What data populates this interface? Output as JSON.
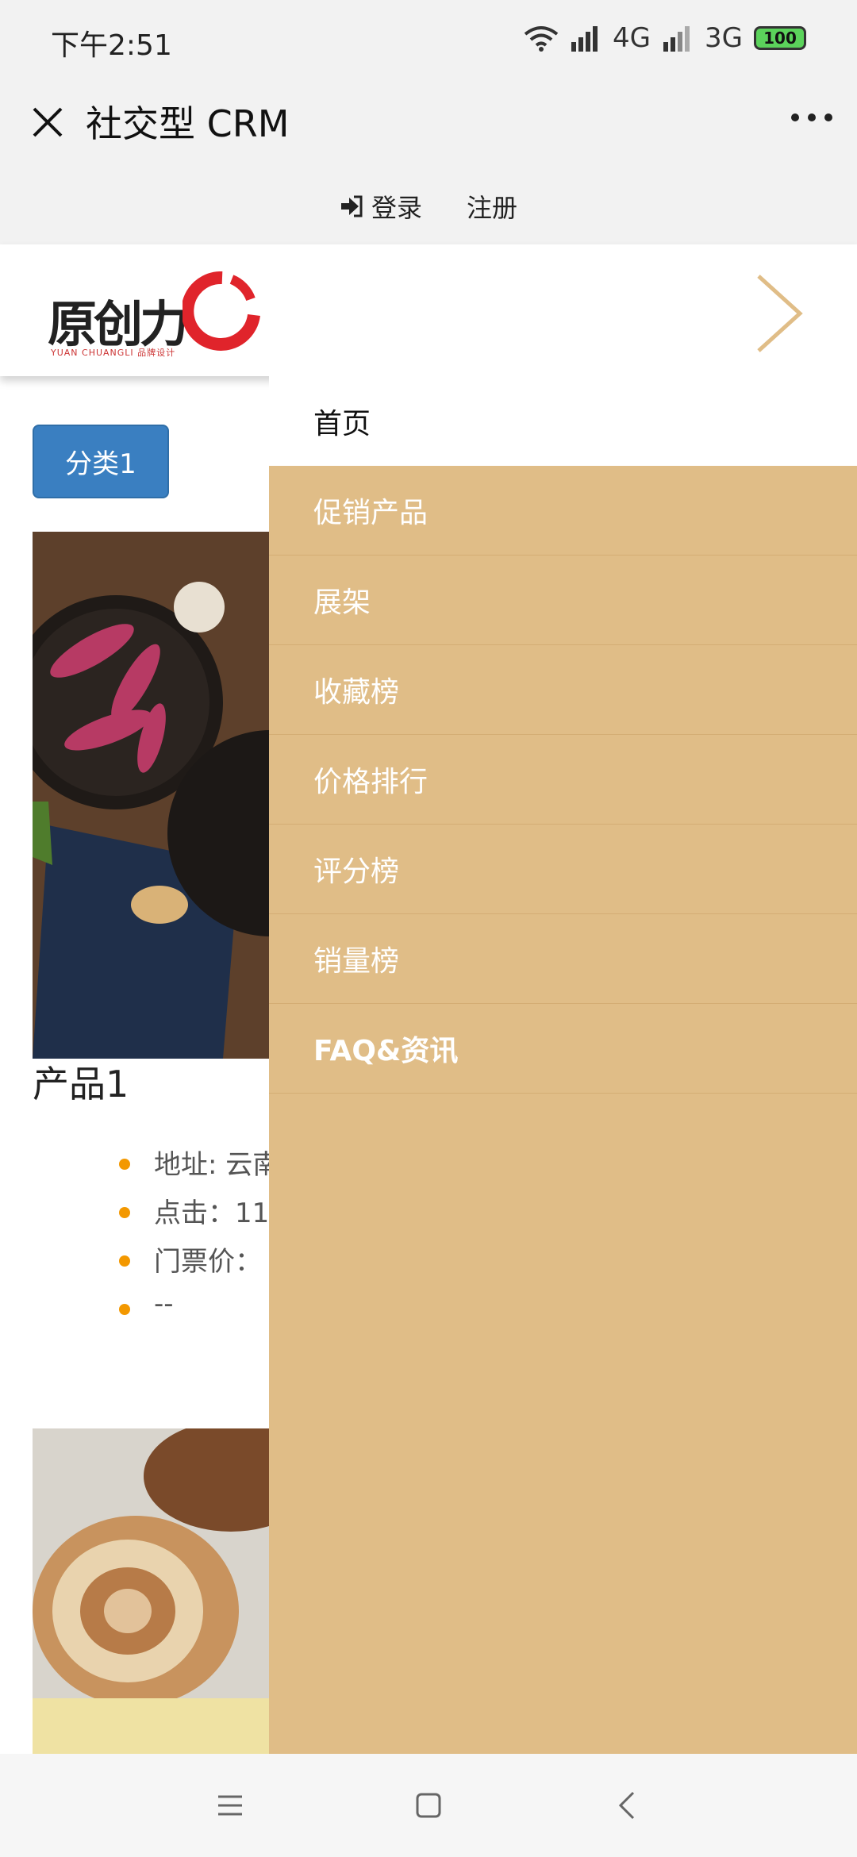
{
  "status_bar": {
    "time": "下午2:51",
    "network1": "4G",
    "network2": "3G",
    "battery": "100",
    "icons": [
      "wifi-icon",
      "signal-icon",
      "battery-icon"
    ]
  },
  "title_bar": {
    "title": "社交型 CRM",
    "close_icon": "close-icon",
    "more_icon": "more-icon"
  },
  "auth": {
    "login": "登录",
    "register": "注册"
  },
  "header": {
    "logo_text": "原创力",
    "logo_sub": "YUAN CHUANGLI 品牌设计"
  },
  "content": {
    "category_button": "分类1",
    "product_title": "产品1",
    "details": [
      "地址: 云南",
      "点击：11",
      "门票价：",
      "--"
    ]
  },
  "menu": {
    "home": "首页",
    "items": [
      "促销产品",
      "展架",
      "收藏榜",
      "价格排行",
      "评分榜",
      "销量榜",
      "FAQ&资讯"
    ]
  },
  "colors": {
    "drawer_bg": "#e0bd87",
    "category_button": "#3a7fc1",
    "bullet": "#f39800"
  }
}
